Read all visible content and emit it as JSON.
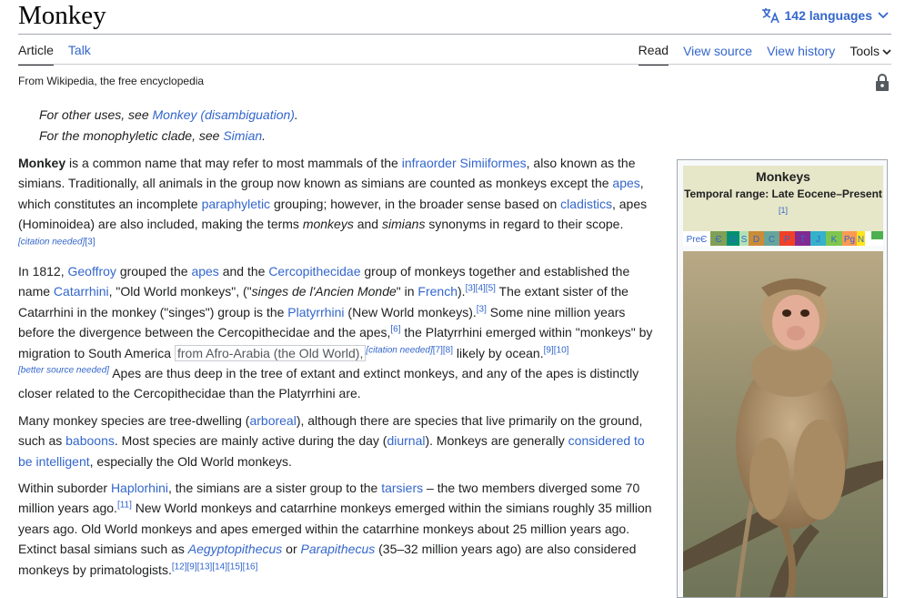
{
  "header": {
    "title": "Monkey",
    "languages_label": "142 languages"
  },
  "tabs": {
    "left": [
      "Article",
      "Talk"
    ],
    "right": [
      "Read",
      "View source",
      "View history"
    ],
    "tools_label": "Tools"
  },
  "tagline": "From Wikipedia, the free encyclopedia",
  "hatnotes": {
    "h1_prefix": "For other uses, see ",
    "h1_link": "Monkey (disambiguation)",
    "h1_suffix": ".",
    "h2_prefix": "For the monophyletic clade, see ",
    "h2_link": "Simian",
    "h2_suffix": "."
  },
  "p1": {
    "bold": "Monkey",
    "t1": " is a common name that may refer to most mammals of the ",
    "l1": "infraorder Simiiformes",
    "t2": ", also known as the simians. Traditionally, all animals in the group now known as simians are counted as monkeys except the ",
    "l2": "apes",
    "t3": ", which constitutes an incomplete ",
    "l3": "paraphyletic",
    "t4": " grouping; however, in the broader sense based on ",
    "l4": "cladistics",
    "t5": ", apes (Hominoidea) are also included, making the terms ",
    "i1": "monkeys",
    "t6": " and ",
    "i2": "simians",
    "t7": " synonyms in regard to their scope.",
    "cite1": "[citation needed]",
    "cite2": "[3]"
  },
  "p2": {
    "t1": "In 1812, ",
    "l1": "Geoffroy",
    "t2": " grouped the ",
    "l2": "apes",
    "t3": " and the ",
    "l3": "Cercopithecidae",
    "t4": " group of monkeys together and established the name ",
    "l4": "Catarrhini",
    "t5": ", \"Old World monkeys\", (\"",
    "i1": "singes de l'Ancien Monde",
    "t6": "\" in ",
    "l5": "French",
    "t7": ").",
    "r1": "[3][4][5]",
    "t8": " The extant sister of the Catarrhini in the monkey (\"singes\") group is the ",
    "l6": "Platyrrhini",
    "t9": " (New World monkeys).",
    "r2": "[3]",
    "t10": " Some nine million years before the divergence between the Cercopithecidae and the apes,",
    "r3": "[6]",
    "t11": " the Platyrrhini emerged within \"monkeys\" by migration to South America ",
    "boxed": "from Afro-Arabia (the Old World),",
    "r4": "[citation needed]",
    "r5": "[7][8]",
    "t12": " likely by ocean.",
    "r6": "[9][10]",
    "r7": "[better source needed]",
    "t13": " Apes are thus deep in the tree of extant and extinct monkeys, and any of the apes is distinctly closer related to the Cercopithecidae than the Platyrrhini are."
  },
  "p3": {
    "t1": "Many monkey species are tree-dwelling (",
    "l1": "arboreal",
    "t2": "), although there are species that live primarily on the ground, such as ",
    "l2": "baboons",
    "t3": ". Most species are mainly active during the day (",
    "l3": "diurnal",
    "t4": "). Monkeys are generally ",
    "l4": "considered to be intelligent",
    "t5": ", especially the Old World monkeys."
  },
  "p4": {
    "t1": "Within suborder ",
    "l1": "Haplorhini",
    "t2": ", the simians are a sister group to the ",
    "l2": "tarsiers",
    "t3": " – the two members diverged some 70 million years ago.",
    "r1": "[11]",
    "t4": " New World monkeys and catarrhine monkeys emerged within the simians roughly 35 million years ago. Old World monkeys and apes emerged within the catarrhine monkeys about 25 million years ago. Extinct basal simians such as ",
    "l3": "Aegyptopithecus",
    "t5": " or ",
    "l4": "Parapithecus",
    "t6": " (35–32 million years ago) are also considered monkeys by primatologists.",
    "r2": "[12][9][13][14][15][16]"
  },
  "infobox": {
    "title": "Monkeys",
    "range": "Temporal range: Late Eocene–Present",
    "ref": "[1]",
    "timeline": [
      {
        "label": "PreЄ",
        "color": "#ffffff",
        "text": "#3366cc"
      },
      {
        "label": "Є",
        "color": "#7fa056",
        "text": "#3366cc"
      },
      {
        "label": "O",
        "color": "#009270",
        "text": "#3366cc"
      },
      {
        "label": "S",
        "color": "#b3e1b6",
        "text": "#3366cc"
      },
      {
        "label": "D",
        "color": "#cb8c37",
        "text": "#3366cc"
      },
      {
        "label": "C",
        "color": "#67a599",
        "text": "#3366cc"
      },
      {
        "label": "P",
        "color": "#f04028",
        "text": "#3366cc"
      },
      {
        "label": "T",
        "color": "#812b92",
        "text": "#3366cc"
      },
      {
        "label": "J",
        "color": "#34b2c9",
        "text": "#3366cc"
      },
      {
        "label": "K",
        "color": "#7fc64e",
        "text": "#3366cc"
      },
      {
        "label": "Pg",
        "color": "#fd9a52",
        "text": "#3366cc"
      },
      {
        "label": "N",
        "color": "#ffe619",
        "text": "#3366cc"
      }
    ]
  }
}
